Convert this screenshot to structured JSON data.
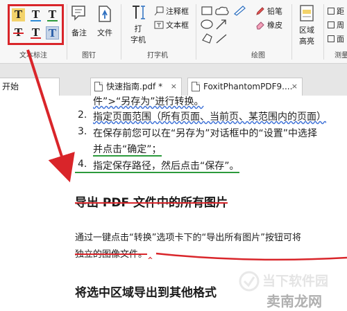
{
  "ribbon": {
    "groups": {
      "text_markup": "文本标注",
      "pin": "图钉",
      "typewriter": "打字机",
      "drawing": "绘图",
      "measure": "测量"
    },
    "text_tools": [
      "T",
      "T",
      "T",
      "T",
      "T",
      "T"
    ],
    "note_label": "备注",
    "file_label": "文件",
    "typewriter_label": "打\n字机",
    "typewriter_l1": "打",
    "typewriter_l2": "字机",
    "callout_label": "注释框",
    "textbox_label": "文本框",
    "pencil_label": "铅笔",
    "eraser_label": "橡皮",
    "area_label_1": "区域",
    "area_label_2": "高亮",
    "measure_items": [
      "距",
      "周",
      "面"
    ]
  },
  "tabs": [
    {
      "label": "开始"
    },
    {
      "label": "快速指南.pdf *",
      "close": "×"
    },
    {
      "label": "FoxitPhantomPDF9....",
      "close": "×"
    }
  ],
  "document": {
    "line_top": "件”>“另存为”进行转换。",
    "items": [
      {
        "num": "2.",
        "text": "指定页面范围（所有页面、当前页、某范围内的页面）"
      },
      {
        "num": "3.",
        "text": "在保存前您可以在“另存为”对话框中的“设置”中选择",
        "cont": "并点击“确定”；"
      },
      {
        "num": "4.",
        "text": "指定保存路径，然后点击“保存”。"
      }
    ],
    "heading1": "导出 PDF 文件中的所有图片",
    "para1_line1": "通过一键点击“转换”选项卡下的“导出所有图片”按钮可将",
    "para1_line2": "独立的图像文件。",
    "heading2": "将选中区域导出到其他格式"
  },
  "watermark": {
    "line1": "当下软件园",
    "line2": "卖南龙网"
  },
  "colors": {
    "annotation_red": "#d9252a",
    "wavy_blue": "#3b6fd6",
    "underline_green": "#2c9a3c"
  }
}
